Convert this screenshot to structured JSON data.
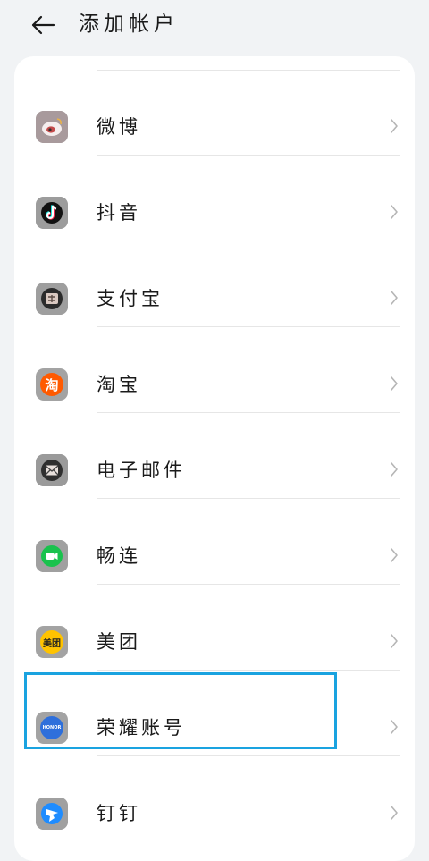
{
  "header": {
    "title": "添加帐户",
    "back_icon": "arrow-left-icon"
  },
  "colors": {
    "background": "#f1f3f5",
    "card": "#ffffff",
    "highlight": "#1aa3e0"
  },
  "accounts": [
    {
      "label": "微博",
      "icon": "weibo-icon"
    },
    {
      "label": "抖音",
      "icon": "douyin-icon"
    },
    {
      "label": "支付宝",
      "icon": "alipay-icon"
    },
    {
      "label": "淘宝",
      "icon": "taobao-icon",
      "icon_text": "淘"
    },
    {
      "label": "电子邮件",
      "icon": "email-icon"
    },
    {
      "label": "畅连",
      "icon": "changlian-icon"
    },
    {
      "label": "美团",
      "icon": "meituan-icon",
      "icon_text": "美团"
    },
    {
      "label": "荣耀账号",
      "icon": "honor-icon",
      "icon_text": "HONOR",
      "highlighted": true
    },
    {
      "label": "钉钉",
      "icon": "dingtalk-icon"
    }
  ]
}
